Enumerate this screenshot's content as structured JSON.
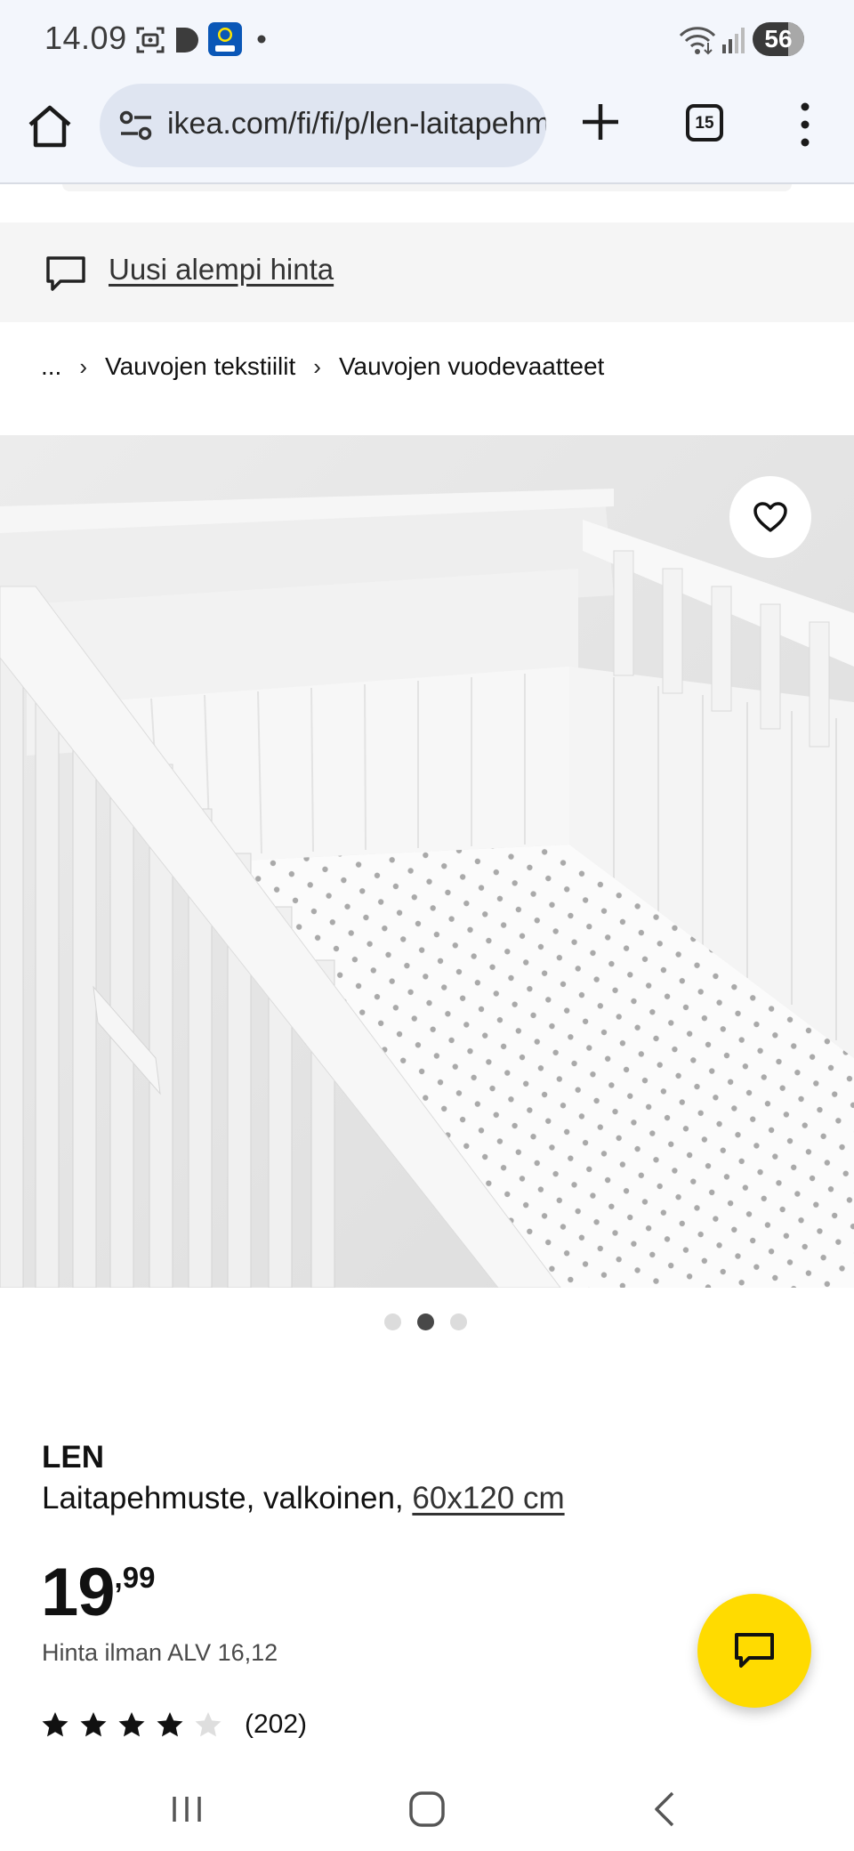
{
  "status_bar": {
    "time": "14.09",
    "battery": "56",
    "icons": [
      "screenshot-icon",
      "play-icon",
      "lidl-plus-icon",
      "notification-dot-icon",
      "wifi-icon",
      "signal-icon",
      "battery-icon"
    ]
  },
  "browser": {
    "url": "ikea.com/fi/fi/p/len-laitapehmuste-valkoinen",
    "tab_count": "15"
  },
  "banner": {
    "link_text": "Uusi alempi hinta"
  },
  "breadcrumb": {
    "ellipsis": "...",
    "items": [
      {
        "label": "Vauvojen tekstiilit"
      },
      {
        "label": "Vauvojen vuodevaatteet"
      }
    ]
  },
  "gallery": {
    "dot_count": 3,
    "active_index": 1
  },
  "product": {
    "name": "LEN",
    "description": "Laitapehmuste, valkoinen, ",
    "size": "60x120 cm",
    "price_integer": "19",
    "price_decimals": ",99",
    "vat_text": "Hinta ilman ALV 16,12",
    "rating": 4,
    "rating_max": 5,
    "review_count": "(202)"
  },
  "colors": {
    "ikea_yellow": "#ffdb00",
    "browser_bg": "#f3f6fc",
    "omnibox_bg": "#dfe5f1",
    "banner_bg": "#f5f5f5"
  }
}
